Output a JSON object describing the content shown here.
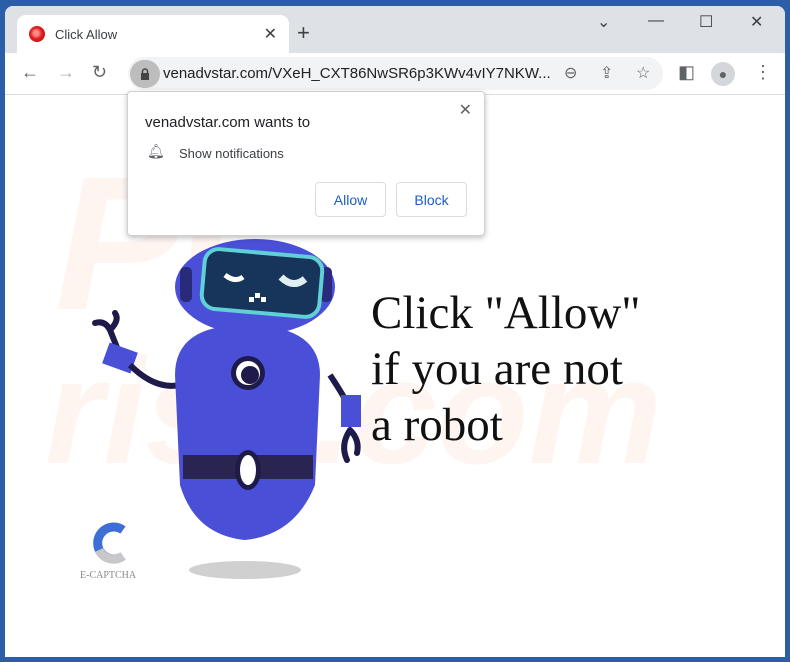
{
  "browser": {
    "tab_title": "Click Allow",
    "url": "venadvstar.com/VXeH_CXT86NwSR6p3KWv4vIY7NKW...",
    "icons": [
      "favicon",
      "close-icon",
      "new-tab-icon",
      "chevron-down-icon",
      "minimize-icon",
      "maximize-icon",
      "window-close-icon",
      "back-icon",
      "forward-icon",
      "reload-icon",
      "lock-icon",
      "zoom-out-icon",
      "share-icon",
      "star-icon",
      "sidebar-icon",
      "profile-icon",
      "menu-icon"
    ]
  },
  "popup": {
    "title": "venadvstar.com wants to",
    "permission": "Show notifications",
    "allow": "Allow",
    "block": "Block"
  },
  "page": {
    "headline_1": "Click \"Allow\"",
    "headline_2": "if you are not",
    "headline_3": "a robot",
    "captcha_label": "E-CAPTCHA",
    "watermark": "PC risk.com"
  },
  "colors": {
    "frame": "#2b5ea7",
    "robot": "#4a4fd8",
    "link": "#1a5fc8"
  }
}
